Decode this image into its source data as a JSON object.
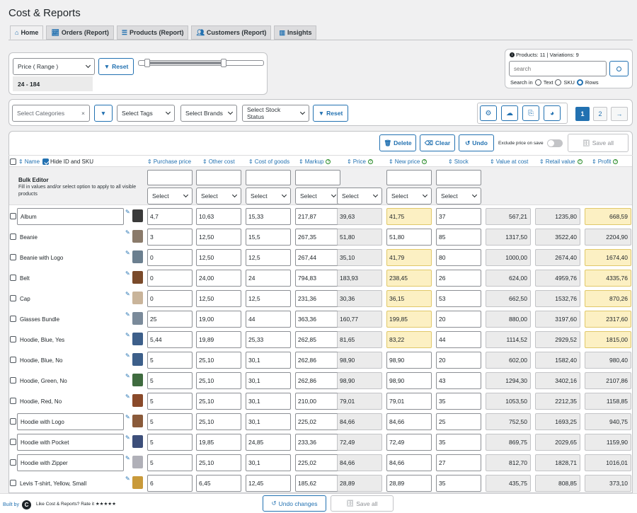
{
  "app": {
    "title": "Cost & Reports"
  },
  "tabs": [
    {
      "label": "Home",
      "icon": "home-icon"
    },
    {
      "label": "Orders (Report)",
      "icon": "chart-line-icon"
    },
    {
      "label": "Products (Report)",
      "icon": "list-icon"
    },
    {
      "label": "Customers (Report)",
      "icon": "users-icon"
    },
    {
      "label": "Insights",
      "icon": "bar-chart-icon"
    }
  ],
  "price_filter": {
    "select_value": "Price ( Range )",
    "reset_label": "Reset",
    "range_text": "24 - 184"
  },
  "search": {
    "info": "Products: 11 | Variations: 9",
    "placeholder": "search",
    "search_in_label": "Search in",
    "options": [
      "Text",
      "SKU",
      "Rows"
    ],
    "selected": "Rows"
  },
  "filters": {
    "categories_placeholder": "Select Categories",
    "tags": "Select Tags",
    "brands": "Select Brands",
    "stock_status": "Select Stock Status",
    "reset_label": "Reset"
  },
  "pagination": {
    "pages": [
      "1",
      "2"
    ],
    "current": "1",
    "next": "→"
  },
  "toolbar": {
    "delete_label": "Delete",
    "clear_label": "Clear",
    "undo_label": "Undo",
    "exclude_label": "Exclude price on save",
    "save_all_label": "Save all"
  },
  "columns": {
    "name": "Name",
    "hide_id_sku": "Hide ID and SKU",
    "purchase_price": "Purchase price",
    "other_cost": "Other cost",
    "cost_of_goods": "Cost of goods",
    "markup": "Markup",
    "price": "Price",
    "new_price": "New price",
    "stock": "Stock",
    "value_at_cost": "Value at cost",
    "retail_value": "Retail value",
    "profit": "Profit"
  },
  "bulk": {
    "title": "Bulk Editor",
    "desc": "Fill in values and/or select option to apply to all visible products",
    "select_label": "Select"
  },
  "rows": [
    {
      "name": "Album",
      "purchase": "4,7",
      "other": "10,63",
      "cog": "15,33",
      "markup": "217,87",
      "price": "39,63",
      "new_price": "41,75",
      "stock": "37",
      "vac": "567,21",
      "retail": "1235,80",
      "profit": "668,59",
      "changed": true
    },
    {
      "name": "Beanie",
      "purchase": "3",
      "other": "12,50",
      "cog": "15,5",
      "markup": "267,35",
      "price": "51,80",
      "new_price": "51,80",
      "stock": "85",
      "vac": "1317,50",
      "retail": "3522,40",
      "profit": "2204,90",
      "changed": false
    },
    {
      "name": "Beanie with Logo",
      "purchase": "0",
      "other": "12,50",
      "cog": "12,5",
      "markup": "267,44",
      "price": "35,10",
      "new_price": "41,79",
      "stock": "80",
      "vac": "1000,00",
      "retail": "2674,40",
      "profit": "1674,40",
      "changed": true
    },
    {
      "name": "Belt",
      "purchase": "0",
      "other": "24,00",
      "cog": "24",
      "markup": "794,83",
      "price": "183,93",
      "new_price": "238,45",
      "stock": "26",
      "vac": "624,00",
      "retail": "4959,76",
      "profit": "4335,76",
      "changed": true
    },
    {
      "name": "Cap",
      "purchase": "0",
      "other": "12,50",
      "cog": "12,5",
      "markup": "231,36",
      "price": "30,36",
      "new_price": "36,15",
      "stock": "53",
      "vac": "662,50",
      "retail": "1532,76",
      "profit": "870,26",
      "changed": true
    },
    {
      "name": "Glasses Bundle",
      "purchase": "25",
      "other": "19,00",
      "cog": "44",
      "markup": "363,36",
      "price": "160,77",
      "new_price": "199,85",
      "stock": "20",
      "vac": "880,00",
      "retail": "3197,60",
      "profit": "2317,60",
      "changed": true
    },
    {
      "name": "Hoodie, Blue, Yes",
      "purchase": "5,44",
      "other": "19,89",
      "cog": "25,33",
      "markup": "262,85",
      "price": "81,65",
      "new_price": "83,22",
      "stock": "44",
      "vac": "1114,52",
      "retail": "2929,52",
      "profit": "1815,00",
      "changed": true
    },
    {
      "name": "Hoodie, Blue, No",
      "purchase": "5",
      "other": "25,10",
      "cog": "30,1",
      "markup": "262,86",
      "price": "98,90",
      "new_price": "98,90",
      "stock": "20",
      "vac": "602,00",
      "retail": "1582,40",
      "profit": "980,40",
      "changed": false
    },
    {
      "name": "Hoodie, Green, No",
      "purchase": "5",
      "other": "25,10",
      "cog": "30,1",
      "markup": "262,86",
      "price": "98,90",
      "new_price": "98,90",
      "stock": "43",
      "vac": "1294,30",
      "retail": "3402,16",
      "profit": "2107,86",
      "changed": false
    },
    {
      "name": "Hoodie, Red, No",
      "purchase": "5",
      "other": "25,10",
      "cog": "30,1",
      "markup": "210,00",
      "price": "79,01",
      "new_price": "79,01",
      "stock": "35",
      "vac": "1053,50",
      "retail": "2212,35",
      "profit": "1158,85",
      "changed": false
    },
    {
      "name": "Hoodie with Logo",
      "purchase": "5",
      "other": "25,10",
      "cog": "30,1",
      "markup": "225,02",
      "price": "84,66",
      "new_price": "84,66",
      "stock": "25",
      "vac": "752,50",
      "retail": "1693,25",
      "profit": "940,75",
      "changed": false
    },
    {
      "name": "Hoodie with Pocket",
      "purchase": "5",
      "other": "19,85",
      "cog": "24,85",
      "markup": "233,36",
      "price": "72,49",
      "new_price": "72,49",
      "stock": "35",
      "vac": "869,75",
      "retail": "2029,65",
      "profit": "1159,90",
      "changed": false
    },
    {
      "name": "Hoodie with Zipper",
      "purchase": "5",
      "other": "25,10",
      "cog": "30,1",
      "markup": "225,02",
      "price": "84,66",
      "new_price": "84,66",
      "stock": "27",
      "vac": "812,70",
      "retail": "1828,71",
      "profit": "1016,01",
      "changed": false
    },
    {
      "name": "Levis T-shirt, Yellow, Small",
      "purchase": "6",
      "other": "6,45",
      "cog": "12,45",
      "markup": "185,62",
      "price": "28,89",
      "new_price": "28,89",
      "stock": "35",
      "vac": "435,75",
      "retail": "808,85",
      "profit": "373,10",
      "changed": false
    }
  ],
  "footer": {
    "built_by": "Built by",
    "rate_text": "Like Cost & Reports? Rate it ★★★★★",
    "undo_changes_label": "Undo changes",
    "save_all_label": "Save all"
  }
}
